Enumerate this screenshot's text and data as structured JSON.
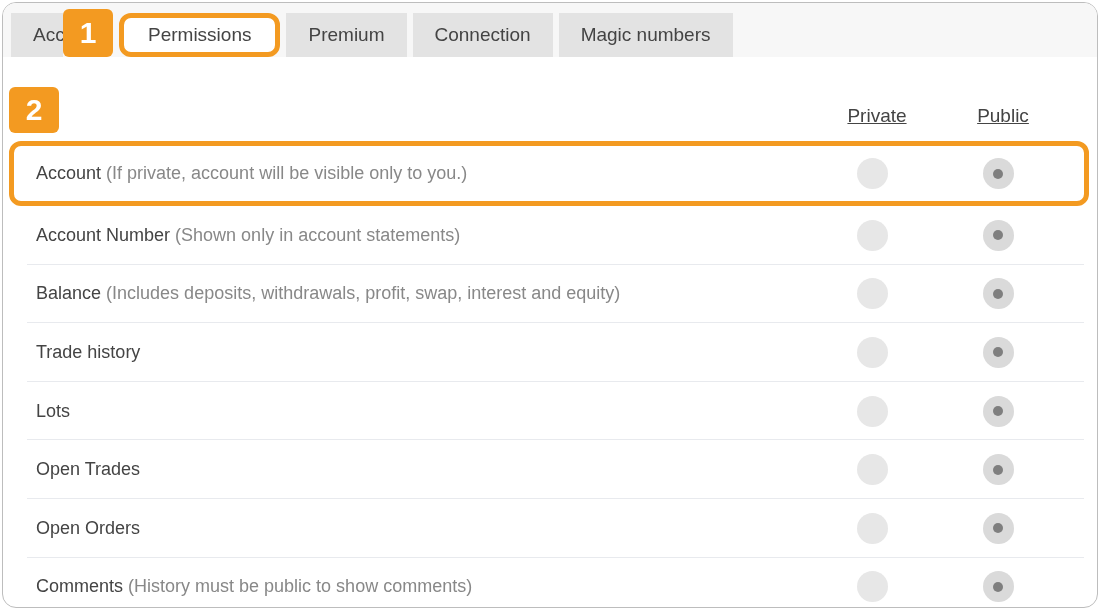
{
  "tabs": [
    {
      "label": "Acc",
      "selected": false
    },
    {
      "label": "Permissions",
      "selected": true,
      "highlighted": true
    },
    {
      "label": "Premium",
      "selected": false
    },
    {
      "label": "Connection",
      "selected": false
    },
    {
      "label": "Magic numbers",
      "selected": false
    }
  ],
  "annotations": [
    {
      "label": "1"
    },
    {
      "label": "2"
    }
  ],
  "columns": [
    "Private",
    "Public"
  ],
  "rows": [
    {
      "label": "Account",
      "note": "(If private, account will be visible only to you.)",
      "highlighted": true,
      "choices": [
        {
          "selected": false
        },
        {
          "selected": true
        }
      ]
    },
    {
      "label": "Account Number",
      "note": "(Shown only in account statements)",
      "highlighted": false,
      "choices": [
        {
          "selected": false
        },
        {
          "selected": true
        }
      ]
    },
    {
      "label": "Balance",
      "note": "(Includes deposits, withdrawals, profit, swap, interest and equity)",
      "highlighted": false,
      "choices": [
        {
          "selected": false
        },
        {
          "selected": true
        }
      ]
    },
    {
      "label": "Trade history",
      "highlighted": false,
      "choices": [
        {
          "selected": false
        },
        {
          "selected": true
        }
      ]
    },
    {
      "label": "Lots",
      "highlighted": false,
      "choices": [
        {
          "selected": false
        },
        {
          "selected": true
        }
      ]
    },
    {
      "label": "Open Trades",
      "highlighted": false,
      "choices": [
        {
          "selected": false
        },
        {
          "selected": true
        }
      ]
    },
    {
      "label": "Open Orders",
      "highlighted": false,
      "choices": [
        {
          "selected": false
        },
        {
          "selected": true
        }
      ]
    },
    {
      "label": "Comments",
      "note": "(History must be public to show comments)",
      "highlighted": false,
      "choices": [
        {
          "selected": false
        },
        {
          "selected": true
        }
      ]
    }
  ]
}
